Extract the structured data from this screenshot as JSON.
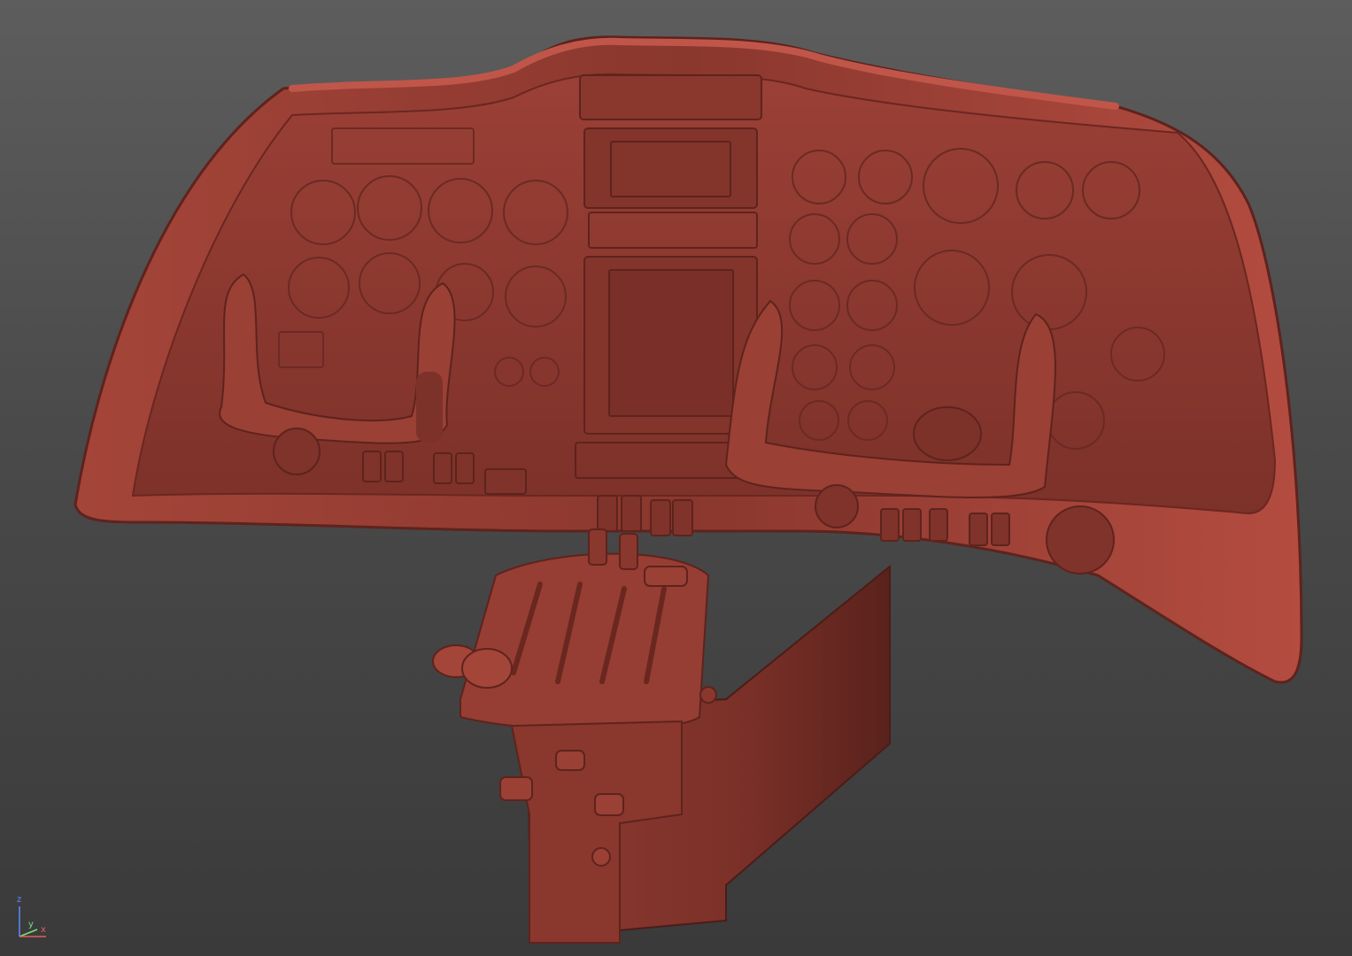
{
  "viewport": {
    "axis_gizmo": {
      "z_label": "z",
      "y_label": "y",
      "x_label": "x"
    }
  },
  "colors": {
    "model_base": "#8e3a30",
    "model_light": "#b04b3f",
    "model_dark": "#5e231d",
    "background_top": "#5d5d5d",
    "background_bottom": "#3a3a3a",
    "axis_z": "#5a8cff",
    "axis_y": "#7ce07c",
    "axis_x": "#e06060"
  }
}
